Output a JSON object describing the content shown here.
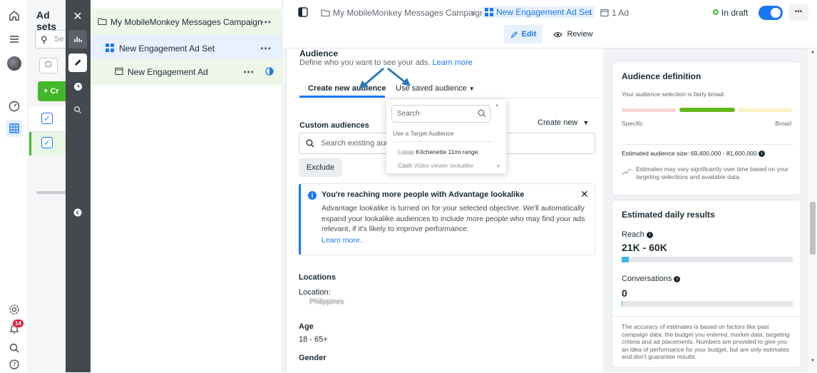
{
  "rail": {
    "icons": [
      "home-icon",
      "menu-icon",
      "avatar",
      "dashboard-icon",
      "grid-icon",
      "settings-icon",
      "bell-icon",
      "search-icon",
      "help-icon"
    ],
    "notification_count": "14"
  },
  "adsets": {
    "title": "Ad sets",
    "search_placeholder": "Se",
    "create_label": "+ Cr"
  },
  "tree": {
    "campaign": "My MobileMonkey Messages Campaign",
    "adset": "New Engagement Ad Set",
    "ad": "New Engagement Ad"
  },
  "header": {
    "crumb_campaign": "My MobileMonkey Messages Campaign",
    "crumb_adset": "New Engagement Ad Set",
    "crumb_ad": "1 Ad",
    "status": "In draft",
    "edit_label": "Edit",
    "review_label": "Review"
  },
  "audience": {
    "title": "Audience",
    "description": "Define who you want to see your ads.",
    "learn_more": "Learn more",
    "tab_create": "Create new audience",
    "tab_saved": "Use saved audience",
    "custom_audiences_label": "Custom audiences",
    "create_new_label": "Create new",
    "search_existing_placeholder": "Search existing aud",
    "exclude_label": "Exclude"
  },
  "dropdown": {
    "search_placeholder": "Search",
    "section_label": "Use a Target Audience",
    "items": [
      "Kitchenette 11mi range",
      "Video viewer lookalike"
    ],
    "blurred_prefixes": [
      "Lasap",
      "Cash"
    ]
  },
  "notice": {
    "title": "You're reaching more people with Advantage lookalike",
    "body": "Advantage lookalike is turned on for your selected objective. We'll automatically expand your lookalike audiences to include more people who may find your ads relevant, if it's likely to improve performance.",
    "link": "Learn more."
  },
  "locations": {
    "title": "Locations",
    "label": "Location:",
    "value_blurred": "Philippines"
  },
  "age": {
    "title": "Age",
    "value": "18 - 65+"
  },
  "gender": {
    "title": "Gender"
  },
  "definition": {
    "title": "Audience definition",
    "summary": "Your audience selection is fairly broad.",
    "specific": "Specific",
    "broad": "Broad",
    "size": "Estimated audience size: 69,400,000 - 81,600,000",
    "note": "Estimates may vary significantly over time based on your targeting selections and available data."
  },
  "daily": {
    "title": "Estimated daily results",
    "reach_label": "Reach",
    "reach_value": "21K - 60K",
    "reach_fill": 0.04,
    "conv_label": "Conversations",
    "conv_value": "0",
    "conv_fill": 0.0,
    "disclaimer": "The accuracy of estimates is based on factors like past campaign data, the budget you entered, market data, targeting criteria and ad placements. Numbers are provided to give you an idea of performance for your budget, but are only estimates and don't guarantee results."
  },
  "colors": {
    "accent": "#1877f2",
    "green": "#42b72a",
    "dark_strip": "#444950",
    "gauge_left": "#fbd5d5",
    "gauge_mid": "#63b71e",
    "gauge_right": "#fdf0c3"
  }
}
